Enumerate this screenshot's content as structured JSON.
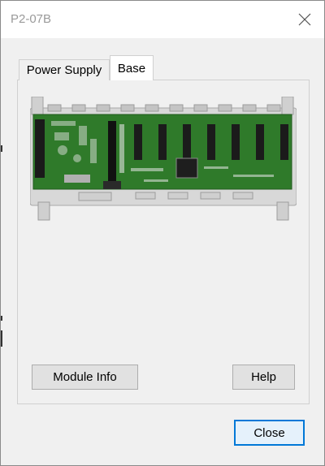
{
  "window": {
    "title": "P2-07B"
  },
  "tabs": [
    {
      "label": "Power Supply",
      "active": false
    },
    {
      "label": "Base",
      "active": true
    }
  ],
  "buttons": {
    "module_info": "Module Info",
    "help": "Help",
    "close": "Close"
  },
  "icons": {
    "close": "close-icon",
    "module": "module-image"
  },
  "colors": {
    "accent": "#0078d7",
    "pcb_green": "#2f7a2a",
    "housing_gray": "#d6d6d6"
  }
}
